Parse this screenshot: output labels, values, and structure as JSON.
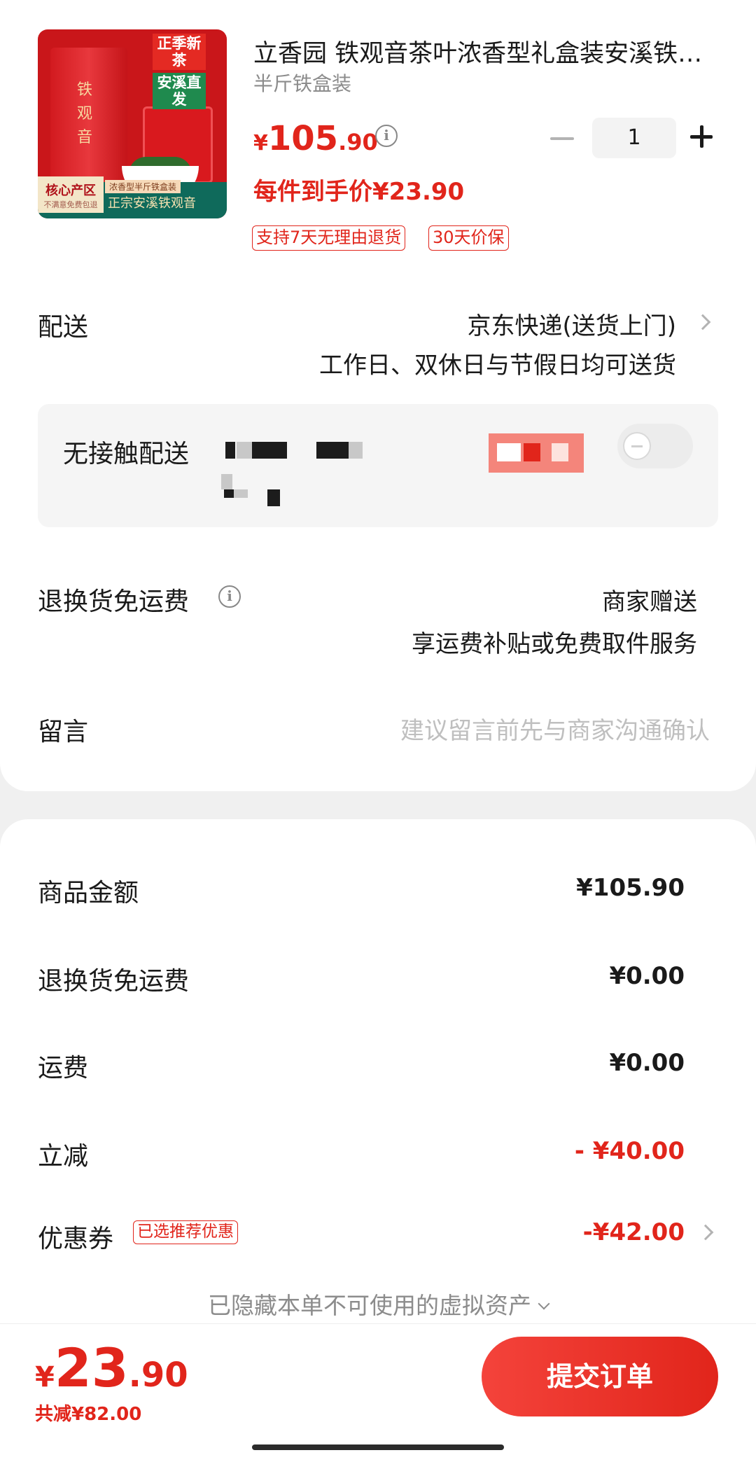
{
  "product": {
    "title": "立香园 铁观音茶叶浓香型礼盒装安溪铁观音新茶",
    "spec": "半斤铁盒装",
    "price_symbol": "¥",
    "price_int": "105",
    "price_dec": ".90",
    "per_item_price": "每件到手价¥23.90",
    "badges": [
      "支持7天无理由退货",
      "30天价保"
    ],
    "quantity": "1",
    "image_text": {
      "can_label": "铁观音",
      "tag_new": "正季新茶",
      "tag_direct": "安溪直发",
      "core": "核心产区",
      "core_sub": "不满意免费包退",
      "pack": "浓香型半斤铁盒装",
      "slogan": "正宗安溪铁观音"
    }
  },
  "delivery": {
    "label": "配送",
    "method": "京东快递(送货上门)",
    "schedule": "工作日、双休日与节假日均可送货"
  },
  "contactless": {
    "label": "无接触配送"
  },
  "return_shipping": {
    "label": "退换货免运费",
    "value": "商家赠送",
    "desc": "享运费补贴或免费取件服务"
  },
  "message": {
    "label": "留言",
    "placeholder": "建议留言前先与商家沟通确认"
  },
  "summary": {
    "goods_label": "商品金额",
    "goods_value": "¥105.90",
    "return_label": "退换货免运费",
    "return_value": "¥0.00",
    "shipping_label": "运费",
    "shipping_value": "¥0.00",
    "discount_label": "立减",
    "discount_value": "- ¥40.00",
    "coupon_label": "优惠券",
    "coupon_tag": "已选推荐优惠",
    "coupon_value": "-¥42.00",
    "hidden_note": "已隐藏本单不可使用的虚拟资产"
  },
  "footer": {
    "total_symbol": "¥",
    "total_int": "23",
    "total_dec": ".90",
    "saved": "共减¥82.00",
    "submit": "提交订单"
  },
  "colors": {
    "accent": "#e1251b",
    "muted": "#8c8c8c"
  }
}
